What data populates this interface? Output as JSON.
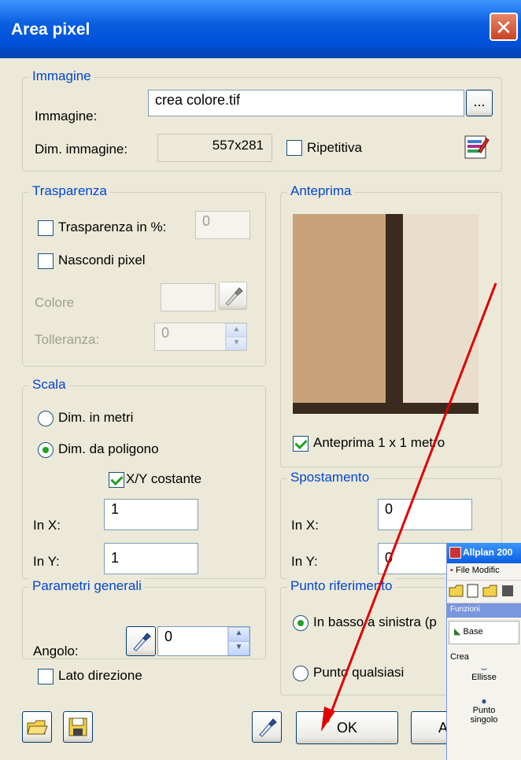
{
  "dialog": {
    "title": "Area pixel",
    "close_icon": "close-icon"
  },
  "immagine": {
    "legend": "Immagine",
    "image_label": "Immagine:",
    "image_value": "crea colore.tif",
    "browse_label": "...",
    "dim_label": "Dim. immagine:",
    "dim_value": "557x281",
    "ripetitiva_label": "Ripetitiva",
    "ripetitiva_checked": false
  },
  "trasparenza": {
    "legend": "Trasparenza",
    "percent_label": "Trasparenza in %:",
    "percent_value": "0",
    "nascondi_label": "Nascondi pixel",
    "colore_label": "Colore",
    "tolleranza_label": "Tolleranza:",
    "tolleranza_value": "0"
  },
  "anteprima": {
    "legend": "Anteprima",
    "preview_label": "Anteprima 1 x 1 metro",
    "preview_checked": true,
    "colors": [
      "#3B2A1E",
      "#C9A27A",
      "#E9DECB"
    ]
  },
  "scala": {
    "legend": "Scala",
    "option_metri": "Dim. in metri",
    "option_poligono": "Dim. da poligono",
    "xy_label": "X/Y costante",
    "in_x_label": "In X:",
    "in_x_value": "1",
    "in_y_label": "In Y:",
    "in_y_value": "1"
  },
  "spostamento": {
    "legend": "Spostamento",
    "in_x_label": "In X:",
    "in_x_value": "0",
    "in_y_label": "In Y:",
    "in_y_value": "0"
  },
  "parametri": {
    "legend": "Parametri generali",
    "angolo_label": "Angolo:",
    "angolo_value": "0",
    "lato_label": "Lato direzione"
  },
  "punto": {
    "legend": "Punto riferimento",
    "option_basso": "In basso a sinistra (p",
    "option_qualsiasi": "Punto qualsiasi"
  },
  "footer": {
    "ok_label": "OK",
    "second_label": "A"
  },
  "allplan_overlay": {
    "title": "Allplan 200",
    "menu_file": "File",
    "menu_modifica": "Modific",
    "funzioni": "Funzioni",
    "base": "Base",
    "crea": "Crea",
    "ellisse": "Ellisse",
    "punto": "Punto",
    "singolo": "singolo"
  },
  "colors": {
    "title_blue": "#0A5FE0",
    "legend_blue": "#0046D5",
    "arrow_red": "#E00000",
    "face": "#ECE9D8"
  }
}
